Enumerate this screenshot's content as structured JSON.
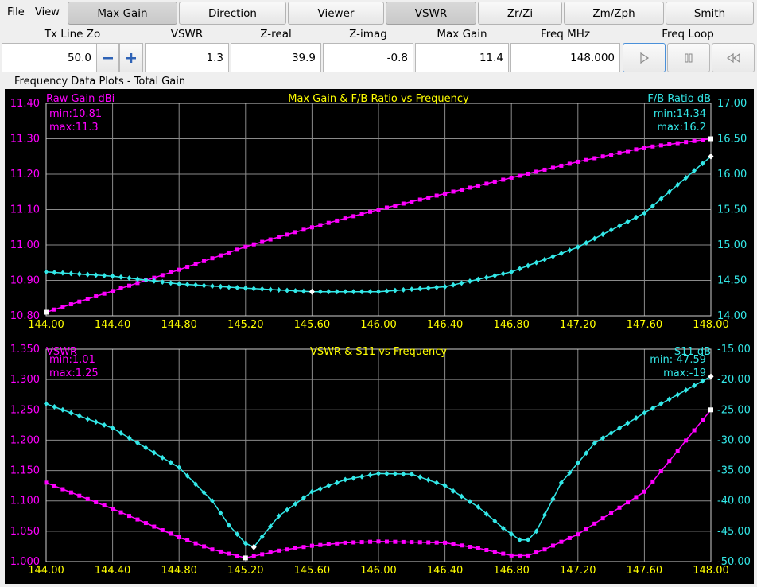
{
  "menu": {
    "file": "File",
    "view": "View"
  },
  "tabs": [
    {
      "label": "Max Gain",
      "active": true
    },
    {
      "label": "Direction",
      "active": false
    },
    {
      "label": "Viewer",
      "active": false
    },
    {
      "label": "VSWR",
      "active": true
    },
    {
      "label": "Zr/Zi",
      "active": false
    },
    {
      "label": "Zm/Zph",
      "active": false
    },
    {
      "label": "Smith",
      "active": false
    }
  ],
  "fields": {
    "tx_line_zo": {
      "label": "Tx Line Zo",
      "value": "50.0"
    },
    "vswr": {
      "label": "VSWR",
      "value": "1.3"
    },
    "z_real": {
      "label": "Z-real",
      "value": "39.9"
    },
    "z_imag": {
      "label": "Z-imag",
      "value": "-0.8"
    },
    "max_gain": {
      "label": "Max Gain",
      "value": "11.4"
    },
    "freq_mhz": {
      "label": "Freq MHz",
      "value": "148.000"
    },
    "freq_loop": {
      "label": "Freq Loop"
    }
  },
  "icons": {
    "minus": "minus-icon",
    "plus": "plus-icon",
    "play": "play-icon",
    "pause": "pause-icon",
    "rewind": "rewind-icon"
  },
  "section_title": "Frequency Data Plots - Total Gain",
  "colors": {
    "magenta": "#ff00ff",
    "cyan": "#33e8e8",
    "yellow": "#ffff00",
    "grid": "#8a8a8a"
  },
  "chart_data": [
    {
      "type": "line",
      "title": "Max Gain & F/B Ratio vs Frequency",
      "left_label": "Raw Gain dBi",
      "right_label": "F/B Ratio dB",
      "left_stats": [
        "min:10.81",
        "max:11.3"
      ],
      "right_stats": [
        "min:14.34",
        "max:16.2"
      ],
      "x_ticks": [
        "144.00",
        "144.40",
        "144.80",
        "145.20",
        "145.60",
        "146.00",
        "146.40",
        "146.80",
        "147.20",
        "147.60",
        "148.00"
      ],
      "xlim": [
        144.0,
        148.0
      ],
      "left_ticks": [
        "11.40",
        "11.30",
        "11.20",
        "11.10",
        "11.00",
        "10.90",
        "10.80"
      ],
      "ylim_left": [
        10.8,
        11.4
      ],
      "right_ticks": [
        "17.00",
        "16.50",
        "16.00",
        "15.50",
        "15.00",
        "14.50",
        "14.00"
      ],
      "ylim_right": [
        14.0,
        17.0
      ],
      "series": [
        {
          "name": "Raw Gain dBi",
          "axis": "left",
          "color": "#ff00ff",
          "x": [
            144.0,
            144.4,
            144.8,
            145.2,
            145.6,
            146.0,
            146.4,
            146.8,
            147.2,
            147.6,
            148.0
          ],
          "y": [
            10.81,
            10.87,
            10.93,
            10.995,
            11.05,
            11.1,
            11.145,
            11.19,
            11.235,
            11.275,
            11.3
          ]
        },
        {
          "name": "F/B Ratio dB",
          "axis": "right",
          "color": "#33e8e8",
          "x": [
            144.0,
            144.4,
            144.8,
            145.2,
            145.6,
            146.0,
            146.4,
            146.8,
            147.2,
            147.6,
            148.0
          ],
          "y": [
            14.62,
            14.56,
            14.45,
            14.39,
            14.34,
            14.34,
            14.41,
            14.62,
            14.97,
            15.45,
            16.25
          ]
        }
      ]
    },
    {
      "type": "line",
      "title": "VSWR & S11 vs Frequency",
      "left_label": "VSWR",
      "right_label": "S11 dB",
      "left_stats": [
        "min:1.01",
        "max:1.25"
      ],
      "right_stats": [
        "min:-47.59",
        "max:-19"
      ],
      "x_ticks": [
        "144.00",
        "144.40",
        "144.80",
        "145.20",
        "145.60",
        "146.00",
        "146.40",
        "146.80",
        "147.20",
        "147.60",
        "148.00"
      ],
      "xlim": [
        144.0,
        148.0
      ],
      "left_ticks": [
        "1.350",
        "1.300",
        "1.250",
        "1.200",
        "1.150",
        "1.100",
        "1.050",
        "1.000"
      ],
      "ylim_left": [
        1.0,
        1.35
      ],
      "right_ticks": [
        "-15.00",
        "-20.00",
        "-25.00",
        "-30.00",
        "-35.00",
        "-40.00",
        "-45.00",
        "-50.00"
      ],
      "ylim_right": [
        -50.0,
        -15.0
      ],
      "series": [
        {
          "name": "VSWR",
          "axis": "left",
          "color": "#ff00ff",
          "x": [
            144.0,
            144.4,
            144.8,
            145.0,
            145.2,
            145.4,
            145.6,
            145.8,
            146.0,
            146.4,
            146.6,
            146.8,
            146.9,
            147.0,
            147.2,
            147.6,
            148.0
          ],
          "y": [
            1.13,
            1.087,
            1.04,
            1.02,
            1.006,
            1.018,
            1.026,
            1.031,
            1.033,
            1.031,
            1.022,
            1.01,
            1.01,
            1.02,
            1.045,
            1.115,
            1.25
          ]
        },
        {
          "name": "S11 dB",
          "axis": "right",
          "color": "#33e8e8",
          "x": [
            144.0,
            144.4,
            144.8,
            145.0,
            145.1,
            145.2,
            145.25,
            145.4,
            145.6,
            145.8,
            146.0,
            146.2,
            146.4,
            146.6,
            146.75,
            146.88,
            146.95,
            147.1,
            147.3,
            147.6,
            148.0
          ],
          "y": [
            -24.0,
            -28.0,
            -34.5,
            -40.0,
            -44.0,
            -47.0,
            -47.6,
            -42.5,
            -38.5,
            -36.5,
            -35.5,
            -35.6,
            -37.5,
            -41.0,
            -44.5,
            -47.0,
            -45.0,
            -37.0,
            -30.5,
            -25.5,
            -19.5
          ]
        }
      ]
    }
  ]
}
